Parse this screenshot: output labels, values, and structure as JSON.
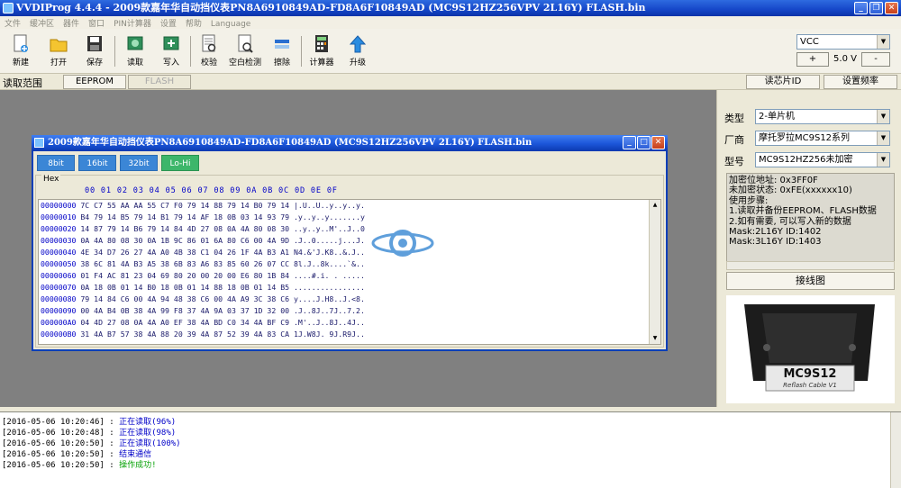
{
  "window": {
    "title": "VVDIProg 4.4.4 - 2009款嘉年华自动挡仪表PN8A6910849AD-FD8A6F10849AD (MC9S12HZ256VPV 2L16Y) FLASH.bin"
  },
  "menu": [
    "文件",
    "缓冲区",
    "器件",
    "窗口",
    "PIN计算器",
    "设置",
    "帮助",
    "Language"
  ],
  "toolbar": {
    "new": "新建",
    "open": "打开",
    "save": "保存",
    "read": "读取",
    "write": "写入",
    "verify": "校验",
    "blank": "空白检测",
    "erase": "擦除",
    "calc": "计算器",
    "upgrade": "升级"
  },
  "vcc": {
    "selected": "VCC",
    "plus": "+",
    "voltage": "5.0 V",
    "minus": "-"
  },
  "read_range": {
    "label": "读取范围",
    "eeprom": "EEPROM",
    "flash": "FLASH"
  },
  "right_buttons": {
    "chip_id": "读芯片ID",
    "freq": "设置频率"
  },
  "right": {
    "type_label": "类型",
    "type_value": "2-单片机",
    "vendor_label": "厂商",
    "vendor_value": "摩托罗拉MC9S12系列",
    "model_label": "型号",
    "model_value": "MC9S12HZ256未加密",
    "info": [
      "加密位地址: 0x3FF0F",
      "未加密状态: 0xFE(xxxxxx10)",
      "使用步骤:",
      "1.读取并备份EEPROM、FLASH数据",
      "2.如有需要, 可以写入新的数据",
      "Mask:2L16Y ID:1402",
      "Mask:3L16Y ID:1403"
    ],
    "wire_button": "接线图",
    "cable_label": "MC9S12",
    "cable_sub": "Reflash Cable V1"
  },
  "child": {
    "title": "2009款嘉年华自动挡仪表PN8A6910849AD-FD8A6F10849AD (MC9S12HZ256VPV 2L16Y) FLASH.bin",
    "bits": [
      "8bit",
      "16bit",
      "32bit",
      "Lo-Hi"
    ],
    "hex_label": "Hex",
    "hex_header": "00 01 02 03 04 05 06 07 08 09 0A 0B 0C 0D 0E 0F",
    "rows": [
      {
        "addr": "00000000",
        "bytes": "7C C7 55 AA AA 55 C7 F0 79 14 88 79 14 B0 79 14",
        "ascii": "|.U..U..y..y..y."
      },
      {
        "addr": "00000010",
        "bytes": "B4 79 14 B5 79 14 B1 79 14 AF 18 0B 03 14 93 79",
        "ascii": ".y..y..y.......y"
      },
      {
        "addr": "00000020",
        "bytes": "14 87 79 14 B6 79 14 84 4D 27 08 0A 4A 80 08 30",
        "ascii": "..y..y..M'..J..0"
      },
      {
        "addr": "00000030",
        "bytes": "0A 4A 80 08 30 0A 1B 9C 86 01 6A 80 C6 00 4A 9D",
        "ascii": ".J..0.....j...J."
      },
      {
        "addr": "00000040",
        "bytes": "4E 34 D7 26 27 4A A0 4B 38 C1 04 26 1F 4A B3 A1",
        "ascii": "N4.&'J.K8..&.J.."
      },
      {
        "addr": "00000050",
        "bytes": "38 6C 81 4A B3 A5 38 6B 83 A6 83 85 60 26 07 CC",
        "ascii": "8l.J..8k....`&.."
      },
      {
        "addr": "00000060",
        "bytes": "01 F4 AC 81 23 04 69 80 20 00 20 00 E6 80 1B 84",
        "ascii": "....#.i. . ....."
      },
      {
        "addr": "00000070",
        "bytes": "0A 18 0B 01 14 B0 18 0B 01 14 88 18 0B 01 14 B5",
        "ascii": "................"
      },
      {
        "addr": "00000080",
        "bytes": "79 14 84 C6 00 4A 94 48 38 C6 00 4A A9 3C 38 C6",
        "ascii": "y....J.H8..J.<8."
      },
      {
        "addr": "00000090",
        "bytes": "00 4A B4 0B 38 4A 99 F8 37 4A 9A 03 37 1D 32 00",
        "ascii": ".J..8J..7J..7.2."
      },
      {
        "addr": "000000A0",
        "bytes": "04 4D 27 08 0A 4A A0 EF 38 4A BD C0 34 4A BF C9",
        "ascii": ".M'..J..8J..4J.."
      },
      {
        "addr": "000000B0",
        "bytes": "31 4A B7 57 38 4A 88 20 39 4A 87 52 39 4A 83 CA",
        "ascii": "1J.W8J. 9J.R9J.."
      }
    ]
  },
  "log": [
    {
      "time": "[2016-05-06 10:20:46]",
      "sep": " : ",
      "msg": "正在读取(96%)",
      "ok": false
    },
    {
      "time": "[2016-05-06 10:20:48]",
      "sep": " : ",
      "msg": "正在读取(98%)",
      "ok": false
    },
    {
      "time": "[2016-05-06 10:20:50]",
      "sep": " : ",
      "msg": "正在读取(100%)",
      "ok": false
    },
    {
      "time": "[2016-05-06 10:20:50]",
      "sep": " : ",
      "msg": "结束通信",
      "ok": false
    },
    {
      "time": "[2016-05-06 10:20:50]",
      "sep": " : ",
      "msg": "操作成功!",
      "ok": true
    }
  ],
  "colors": {
    "titlebar": "#1546c8",
    "workspace": "#808080",
    "bit_button": "#3b86d6",
    "bit_selected": "#3db66a",
    "log_msg": "#0000c8",
    "log_ok": "#00a000"
  }
}
